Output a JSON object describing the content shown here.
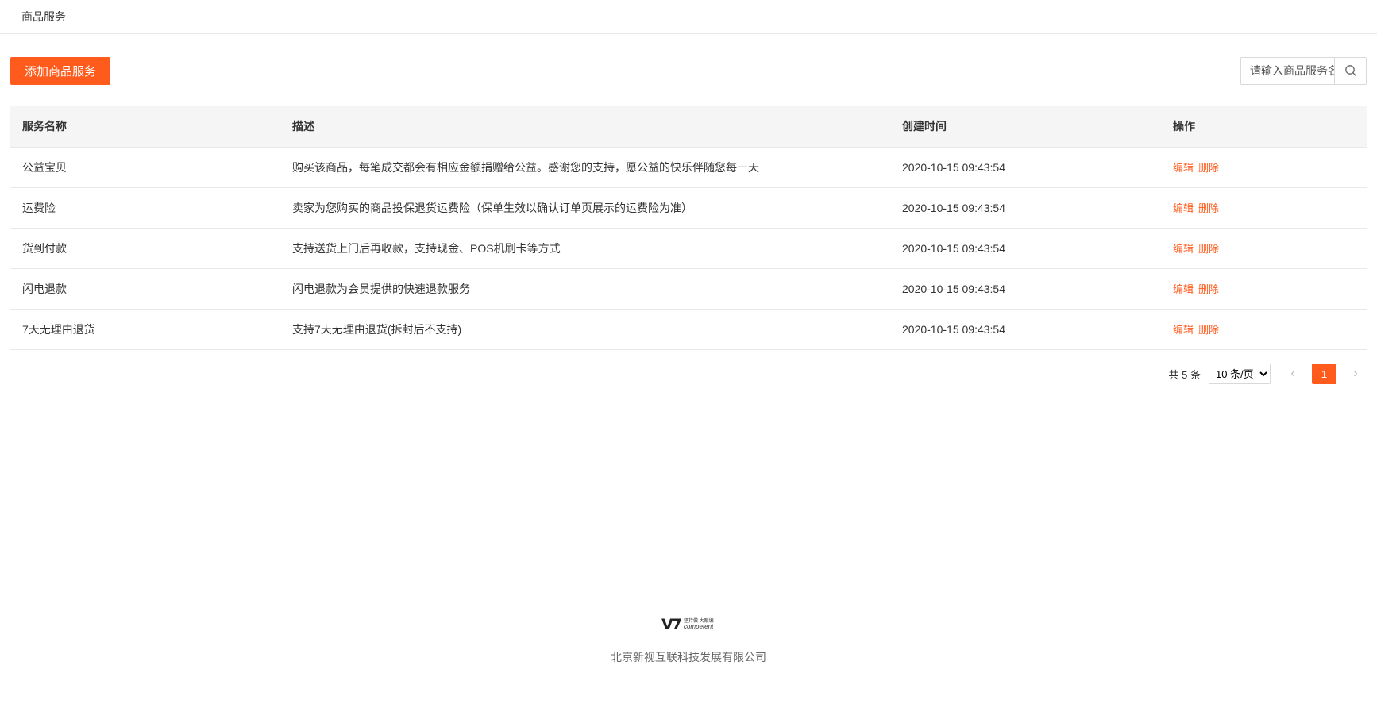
{
  "header": {
    "title": "商品服务"
  },
  "toolbar": {
    "add_label": "添加商品服务",
    "search_placeholder": "请输入商品服务名称"
  },
  "table": {
    "columns": [
      "服务名称",
      "描述",
      "创建时间",
      "操作"
    ],
    "rows": [
      {
        "name": "公益宝贝",
        "desc": "购买该商品，每笔成交都会有相应金额捐赠给公益。感谢您的支持，愿公益的快乐伴随您每一天",
        "time": "2020-10-15 09:43:54",
        "edit": "编辑",
        "delete": "删除"
      },
      {
        "name": "运费险",
        "desc": "卖家为您购买的商品投保退货运费险（保单生效以确认订单页展示的运费险为准）",
        "time": "2020-10-15 09:43:54",
        "edit": "编辑",
        "delete": "删除"
      },
      {
        "name": "货到付款",
        "desc": "支持送货上门后再收款，支持现金、POS机刷卡等方式",
        "time": "2020-10-15 09:43:54",
        "edit": "编辑",
        "delete": "删除"
      },
      {
        "name": "闪电退款",
        "desc": "闪电退款为会员提供的快速退款服务",
        "time": "2020-10-15 09:43:54",
        "edit": "编辑",
        "delete": "删除"
      },
      {
        "name": "7天无理由退货",
        "desc": "支持7天无理由退货(拆封后不支持)",
        "time": "2020-10-15 09:43:54",
        "edit": "编辑",
        "delete": "删除"
      }
    ]
  },
  "pagination": {
    "total_label": "共 5 条",
    "page_size_selected": "10 条/页",
    "current_page": "1",
    "prev_icon": "chevron-left-icon",
    "next_icon": "chevron-right-icon"
  },
  "footer": {
    "logo_cn": "坚持做 大贩编",
    "logo_en": "competent",
    "company": "北京新视互联科技发展有限公司"
  },
  "colors": {
    "accent": "#ff5b1c",
    "header_bg": "#f5f5f5",
    "border": "#e8e8e8"
  }
}
